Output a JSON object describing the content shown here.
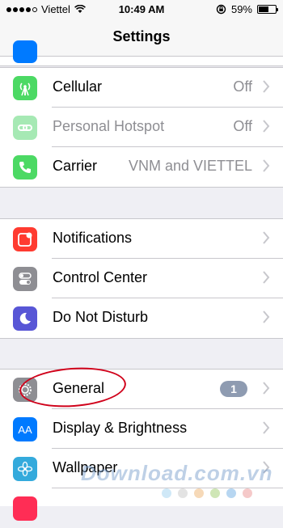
{
  "status_bar": {
    "carrier": "Viettel",
    "time": "10:49 AM",
    "battery_percent": "59%",
    "battery_level": 0.59
  },
  "nav": {
    "title": "Settings"
  },
  "groups": [
    {
      "rows": [
        {
          "label": "Cellular",
          "value": "Off",
          "icon": "cellular-antenna-icon",
          "color": "#4cd964"
        },
        {
          "label": "Personal Hotspot",
          "value": "Off",
          "icon": "hotspot-chain-icon",
          "color": "#a6e9b4",
          "disabled": true
        },
        {
          "label": "Carrier",
          "value": "VNM and VIETTEL",
          "icon": "phone-icon",
          "color": "#4cd964"
        }
      ]
    },
    {
      "rows": [
        {
          "label": "Notifications",
          "icon": "notifications-icon",
          "color": "#ff3b30"
        },
        {
          "label": "Control Center",
          "icon": "control-center-icon",
          "color": "#8e8e93"
        },
        {
          "label": "Do Not Disturb",
          "icon": "moon-icon",
          "color": "#5856d6"
        }
      ]
    },
    {
      "rows": [
        {
          "label": "General",
          "badge": "1",
          "icon": "gear-icon",
          "color": "#8e8e93"
        },
        {
          "label": "Display & Brightness",
          "icon": "display-aa-icon",
          "color": "#007aff",
          "icon_text": "AA"
        },
        {
          "label": "Wallpaper",
          "icon": "wallpaper-flower-icon",
          "color": "#34aadc"
        }
      ]
    }
  ],
  "watermark": {
    "text": "Download.com.vn"
  },
  "colors": {
    "annotation_circle": "#d0021b",
    "watermark_dots": [
      "#cfe8f7",
      "#e3e3e3",
      "#f6d9b8",
      "#cfe6b6",
      "#b7d6f1",
      "#f5c9c9"
    ]
  }
}
